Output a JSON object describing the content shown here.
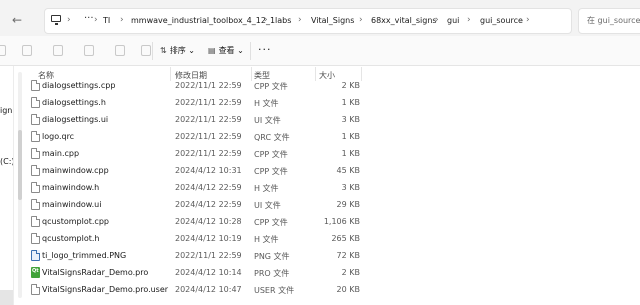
{
  "address_bar": {
    "breadcrumbs": [
      "TI",
      "mmwave_industrial_toolbox_4_12_1",
      "labs",
      "Vital_Signs",
      "68xx_vital_signs",
      "gui",
      "gui_source"
    ],
    "search_placeholder": "在 gui_source 中"
  },
  "toolbar": {
    "sort_label": "排序",
    "view_label": "查看",
    "more_label": "···"
  },
  "nav_pane": {
    "items": [
      "ign",
      "(C:)"
    ]
  },
  "columns": {
    "name": "名称",
    "date": "修改日期",
    "type": "类型",
    "size": "大小"
  },
  "files": [
    {
      "name": "dialogsettings.cpp",
      "date": "2022/11/1 22:59",
      "type": "CPP 文件",
      "size": "2 KB",
      "icon": "file-icon"
    },
    {
      "name": "dialogsettings.h",
      "date": "2022/11/1 22:59",
      "type": "H 文件",
      "size": "1 KB",
      "icon": "file-icon"
    },
    {
      "name": "dialogsettings.ui",
      "date": "2022/11/1 22:59",
      "type": "UI 文件",
      "size": "3 KB",
      "icon": "file-icon"
    },
    {
      "name": "logo.qrc",
      "date": "2022/11/1 22:59",
      "type": "QRC 文件",
      "size": "1 KB",
      "icon": "file-icon"
    },
    {
      "name": "main.cpp",
      "date": "2022/11/1 22:59",
      "type": "CPP 文件",
      "size": "1 KB",
      "icon": "file-icon"
    },
    {
      "name": "mainwindow.cpp",
      "date": "2024/4/12 10:31",
      "type": "CPP 文件",
      "size": "45 KB",
      "icon": "file-icon"
    },
    {
      "name": "mainwindow.h",
      "date": "2024/4/12 22:59",
      "type": "H 文件",
      "size": "3 KB",
      "icon": "file-icon"
    },
    {
      "name": "mainwindow.ui",
      "date": "2024/4/12 22:59",
      "type": "UI 文件",
      "size": "29 KB",
      "icon": "file-icon"
    },
    {
      "name": "qcustomplot.cpp",
      "date": "2024/4/12 10:28",
      "type": "CPP 文件",
      "size": "1,106 KB",
      "icon": "file-icon"
    },
    {
      "name": "qcustomplot.h",
      "date": "2024/4/12 10:19",
      "type": "H 文件",
      "size": "265 KB",
      "icon": "file-icon"
    },
    {
      "name": "ti_logo_trimmed.PNG",
      "date": "2022/11/1 22:59",
      "type": "PNG 文件",
      "size": "72 KB",
      "icon": "image-file-icon"
    },
    {
      "name": "VitalSignsRadar_Demo.pro",
      "date": "2024/4/12 10:14",
      "type": "PRO 文件",
      "size": "2 KB",
      "icon": "qt-project-icon"
    },
    {
      "name": "VitalSignsRadar_Demo.pro.user",
      "date": "2024/4/12 10:47",
      "type": "USER 文件",
      "size": "20 KB",
      "icon": "file-icon"
    }
  ]
}
